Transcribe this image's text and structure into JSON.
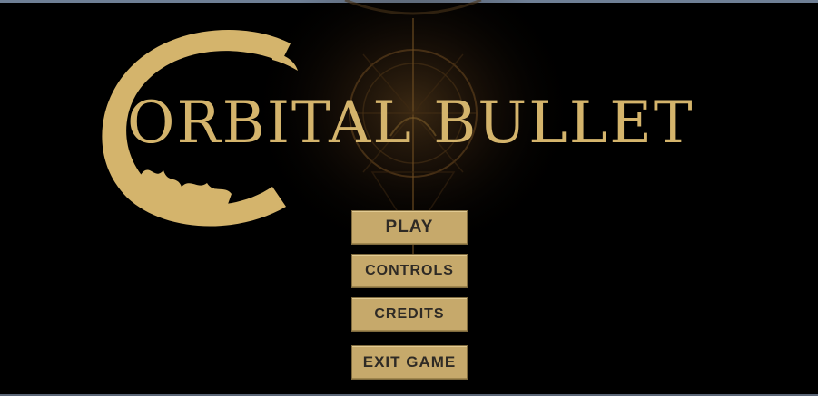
{
  "title": "ORBITAL BULLET",
  "menu": {
    "play_label": "PLAY",
    "controls_label": "CONTROLS",
    "credits_label": "CREDITS",
    "exit_label": "EXIT GAME"
  },
  "colors": {
    "background": "#000000",
    "gold": "#d4b46c",
    "button_fill": "#c6a96b",
    "button_text": "#2e2a25"
  },
  "icons": {
    "logo": "crescent-ring-logo-icon",
    "background_art": "elden-ring-sigil-icon"
  }
}
